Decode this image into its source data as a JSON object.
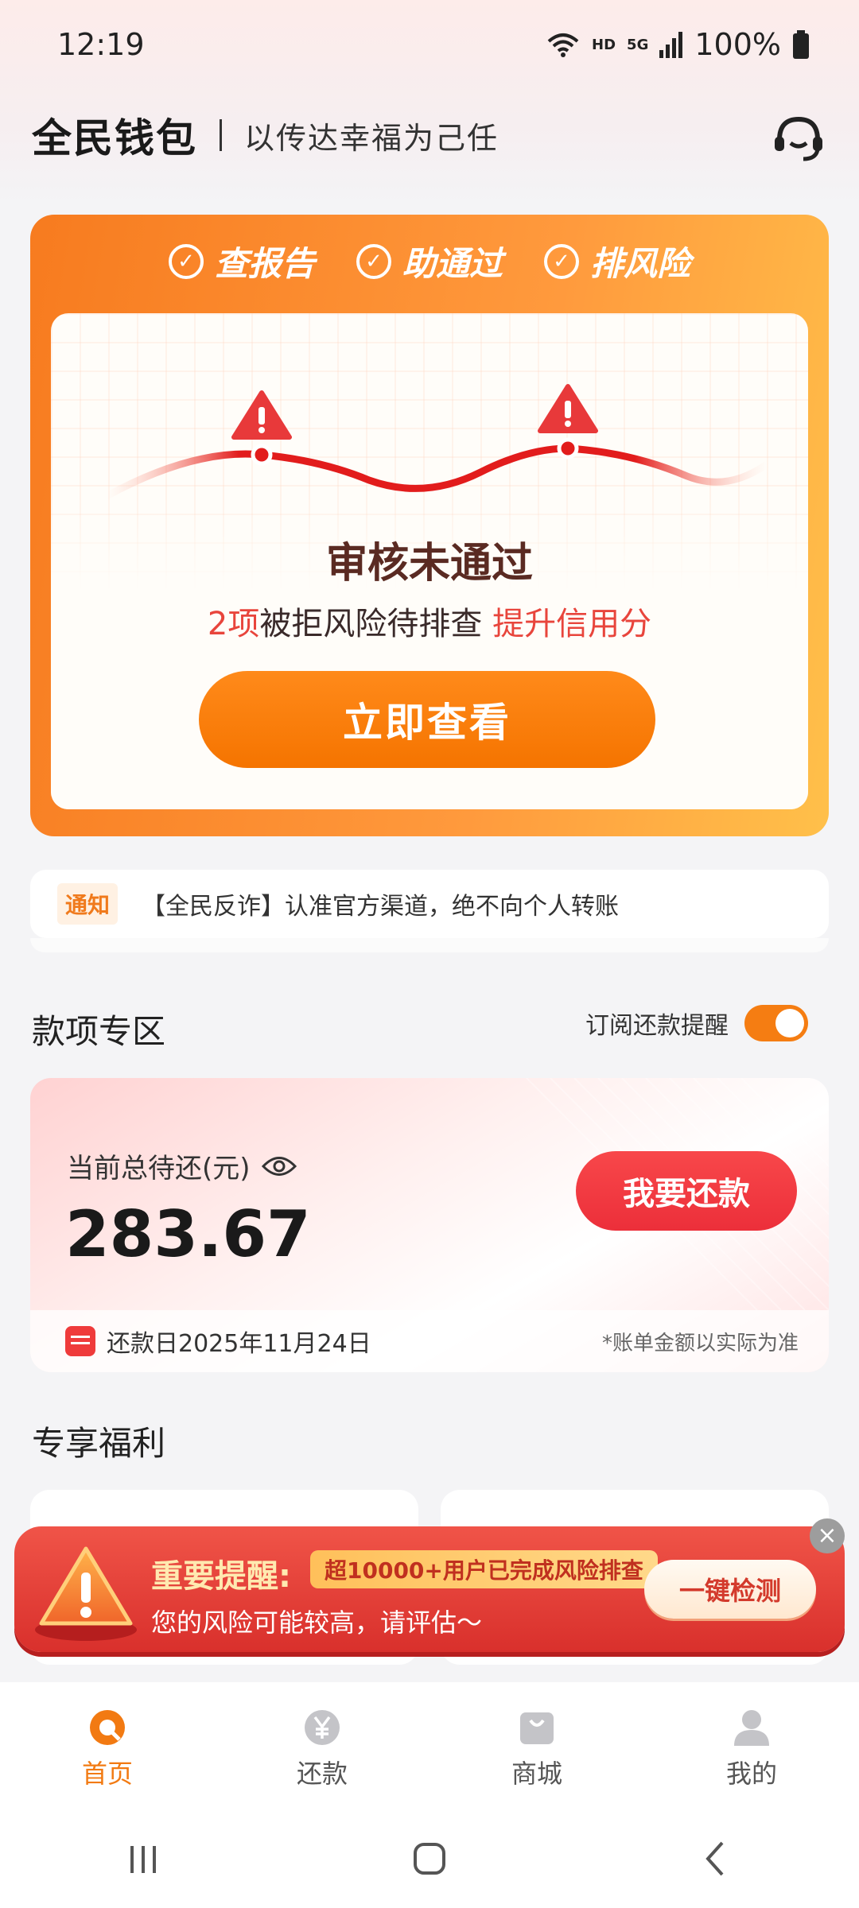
{
  "status_bar": {
    "time": "12:19",
    "hd_label": "HD",
    "network_label": "5G",
    "battery": "100%"
  },
  "header": {
    "brand": "全民钱包",
    "slogan": "以传达幸福为己任",
    "service_icon": "customer-service-icon"
  },
  "hero": {
    "tabs": [
      "查报告",
      "助通过",
      "排风险"
    ],
    "title": "审核未通过",
    "risk_count": "2项",
    "risk_text": "被拒风险待排查",
    "risk_action": "提升信用分",
    "button": "立即查看",
    "colors": {
      "accent": "#f77b1f",
      "danger": "#e21c1c"
    }
  },
  "notice": {
    "tag": "通知",
    "text": "【全民反诈】认准官方渠道，绝不向个人转账"
  },
  "funds": {
    "section_title": "款项专区",
    "subscribe_label": "订阅还款提醒",
    "subscribe_on": true,
    "total_label": "当前总待还(元)",
    "amount": "283.67",
    "repay_button": "我要还款",
    "due_date": "还款日2025年11月24日",
    "note": "*账单金额以实际为准"
  },
  "benefits": {
    "section_title": "专享福利"
  },
  "alert": {
    "title": "重要提醒:",
    "pill": "超10000+用户已完成风险排查",
    "subtitle": "您的风险可能较高，请评估～",
    "button": "一键检测",
    "close": "×"
  },
  "bottom_nav": {
    "items": [
      {
        "label": "首页",
        "icon": "home-icon",
        "active": true
      },
      {
        "label": "还款",
        "icon": "yuan-icon",
        "active": false
      },
      {
        "label": "商城",
        "icon": "shopping-bag-icon",
        "active": false
      },
      {
        "label": "我的",
        "icon": "user-icon",
        "active": false
      }
    ]
  }
}
